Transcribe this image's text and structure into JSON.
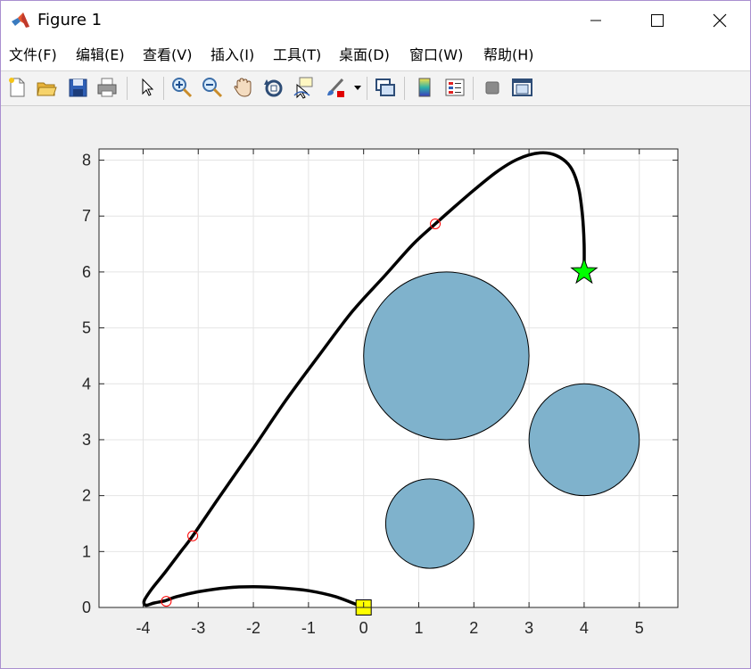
{
  "window": {
    "title": "Figure 1",
    "controls": [
      "minimize",
      "maximize",
      "close"
    ]
  },
  "menu": {
    "items": [
      {
        "label": "文件(F)"
      },
      {
        "label": "编辑(E)"
      },
      {
        "label": "查看(V)"
      },
      {
        "label": "插入(I)"
      },
      {
        "label": "工具(T)"
      },
      {
        "label": "桌面(D)"
      },
      {
        "label": "窗口(W)"
      },
      {
        "label": "帮助(H)"
      }
    ]
  },
  "toolbar": {
    "buttons": [
      "new-figure-icon",
      "open-file-icon",
      "save-icon",
      "print-icon",
      "edit-plot-arrow-icon",
      "zoom-in-icon",
      "zoom-out-icon",
      "pan-hand-icon",
      "rotate-3d-icon",
      "data-cursor-icon",
      "brush-icon",
      "link-plot-icon",
      "insert-colorbar-icon",
      "insert-legend-icon",
      "hide-plot-tools-icon",
      "show-plot-tools-icon"
    ]
  },
  "colors": {
    "obstacle_fill": "#7fb2cc",
    "path": "#000000",
    "waypoint": "#ff0000",
    "start_marker": "#ffff00",
    "goal_marker": "#00ff00",
    "grid": "#e4e4e4"
  },
  "chart_data": {
    "type": "line",
    "xlim": [
      -4.8,
      5.7
    ],
    "ylim": [
      0,
      8.2
    ],
    "xticks": [
      -4,
      -3,
      -2,
      -1,
      0,
      1,
      2,
      3,
      4,
      5
    ],
    "yticks": [
      0,
      1,
      2,
      3,
      4,
      5,
      6,
      7,
      8
    ],
    "grid": true,
    "obstacles": [
      {
        "cx": 1.5,
        "cy": 4.5,
        "r": 1.5
      },
      {
        "cx": 4.0,
        "cy": 3.0,
        "r": 1.0
      },
      {
        "cx": 1.2,
        "cy": 1.5,
        "r": 0.8
      }
    ],
    "path": [
      [
        0.0,
        0.0
      ],
      [
        -0.5,
        0.19
      ],
      [
        -1.0,
        0.3
      ],
      [
        -1.5,
        0.35
      ],
      [
        -2.0,
        0.37
      ],
      [
        -2.5,
        0.35
      ],
      [
        -3.0,
        0.28
      ],
      [
        -3.4,
        0.19
      ],
      [
        -3.6,
        0.12
      ],
      [
        -3.8,
        0.08
      ],
      [
        -3.95,
        0.04
      ],
      [
        -3.98,
        0.12
      ],
      [
        -3.85,
        0.32
      ],
      [
        -3.6,
        0.63
      ],
      [
        -3.3,
        1.02
      ],
      [
        -3.1,
        1.28
      ],
      [
        -2.6,
        2.0
      ],
      [
        -2.0,
        2.85
      ],
      [
        -1.4,
        3.72
      ],
      [
        -0.8,
        4.52
      ],
      [
        -0.2,
        5.3
      ],
      [
        0.4,
        5.95
      ],
      [
        0.9,
        6.5
      ],
      [
        1.3,
        6.86
      ],
      [
        1.9,
        7.38
      ],
      [
        2.4,
        7.78
      ],
      [
        2.8,
        8.02
      ],
      [
        3.2,
        8.13
      ],
      [
        3.5,
        8.08
      ],
      [
        3.75,
        7.88
      ],
      [
        3.9,
        7.5
      ],
      [
        3.97,
        7.0
      ],
      [
        4.0,
        6.5
      ],
      [
        4.0,
        6.0
      ]
    ],
    "waypoints": [
      [
        -3.58,
        0.11
      ],
      [
        -3.1,
        1.28
      ],
      [
        1.3,
        6.86
      ]
    ],
    "start": {
      "x": 0.0,
      "y": 0.0,
      "marker": "square"
    },
    "goal": {
      "x": 4.0,
      "y": 6.0,
      "marker": "pentagram"
    }
  }
}
